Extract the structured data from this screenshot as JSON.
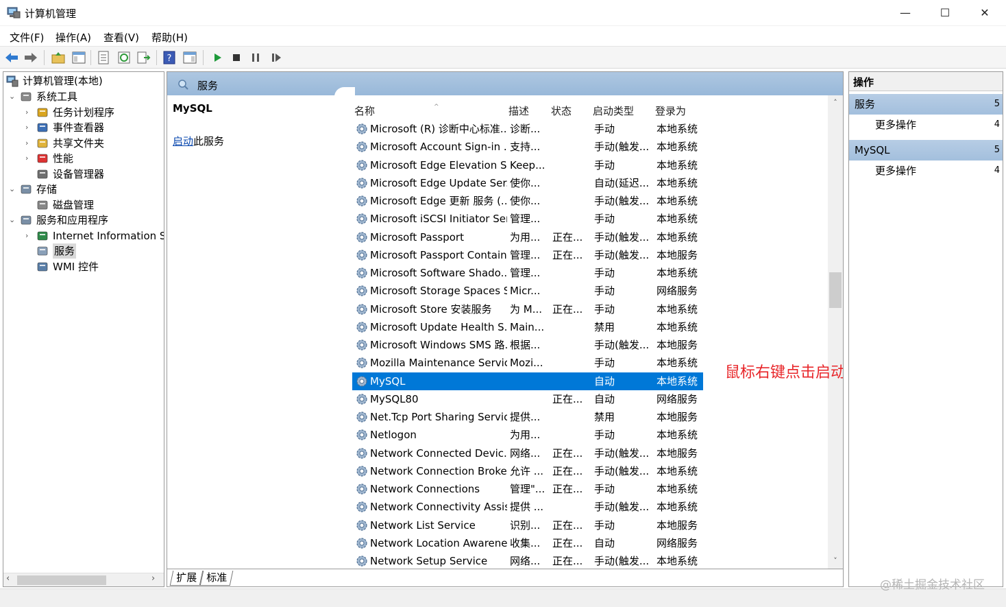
{
  "window": {
    "title": "计算机管理",
    "minimize": "—",
    "maximize": "☐",
    "close": "✕"
  },
  "menu": [
    "文件(F)",
    "操作(A)",
    "查看(V)",
    "帮助(H)"
  ],
  "tree": {
    "root": "计算机管理(本地)",
    "nodes": [
      {
        "label": "系统工具",
        "icon": "tools-icon",
        "level": 1,
        "expander": "⌄"
      },
      {
        "label": "任务计划程序",
        "icon": "clock-icon",
        "level": 2,
        "expander": "›"
      },
      {
        "label": "事件查看器",
        "icon": "event-viewer-icon",
        "level": 2,
        "expander": "›"
      },
      {
        "label": "共享文件夹",
        "icon": "shared-folder-icon",
        "level": 2,
        "expander": "›"
      },
      {
        "label": "性能",
        "icon": "performance-icon",
        "level": 2,
        "expander": "›"
      },
      {
        "label": "设备管理器",
        "icon": "device-manager-icon",
        "level": 2,
        "expander": ""
      },
      {
        "label": "存储",
        "icon": "storage-icon",
        "level": 1,
        "expander": "⌄"
      },
      {
        "label": "磁盘管理",
        "icon": "disk-icon",
        "level": 2,
        "expander": ""
      },
      {
        "label": "服务和应用程序",
        "icon": "services-apps-icon",
        "level": 1,
        "expander": "⌄"
      },
      {
        "label": "Internet Information Se",
        "icon": "iis-icon",
        "level": 2,
        "expander": "›"
      },
      {
        "label": "服务",
        "icon": "services-icon",
        "level": 2,
        "expander": "",
        "selected": true
      },
      {
        "label": "WMI 控件",
        "icon": "wmi-icon",
        "level": 2,
        "expander": ""
      }
    ]
  },
  "center": {
    "header": "服务",
    "detail_title": "MySQL",
    "detail_link": "启动",
    "detail_suffix": "此服务",
    "columns": {
      "name": "名称",
      "desc": "描述",
      "state": "状态",
      "startup": "启动类型",
      "logon": "登录为"
    },
    "sort_arrow": "^",
    "rows": [
      {
        "name": "Microsoft (R) 诊断中心标准...",
        "desc": "诊断...",
        "state": "",
        "startup": "手动",
        "logon": "本地系统"
      },
      {
        "name": "Microsoft Account Sign-in ...",
        "desc": "支持...",
        "state": "",
        "startup": "手动(触发...",
        "logon": "本地系统"
      },
      {
        "name": "Microsoft Edge Elevation S...",
        "desc": "Keep...",
        "state": "",
        "startup": "手动",
        "logon": "本地系统"
      },
      {
        "name": "Microsoft Edge Update Ser...",
        "desc": "使你...",
        "state": "",
        "startup": "自动(延迟...",
        "logon": "本地系统"
      },
      {
        "name": "Microsoft Edge 更新 服务 (...",
        "desc": "使你...",
        "state": "",
        "startup": "手动(触发...",
        "logon": "本地系统"
      },
      {
        "name": "Microsoft iSCSI Initiator Ser...",
        "desc": "管理...",
        "state": "",
        "startup": "手动",
        "logon": "本地系统"
      },
      {
        "name": "Microsoft Passport",
        "desc": "为用...",
        "state": "正在...",
        "startup": "手动(触发...",
        "logon": "本地系统"
      },
      {
        "name": "Microsoft Passport Container",
        "desc": "管理...",
        "state": "正在...",
        "startup": "手动(触发...",
        "logon": "本地服务"
      },
      {
        "name": "Microsoft Software Shado...",
        "desc": "管理...",
        "state": "",
        "startup": "手动",
        "logon": "本地系统"
      },
      {
        "name": "Microsoft Storage Spaces S...",
        "desc": "Micr...",
        "state": "",
        "startup": "手动",
        "logon": "网络服务"
      },
      {
        "name": "Microsoft Store 安装服务",
        "desc": "为 M...",
        "state": "正在...",
        "startup": "手动",
        "logon": "本地系统"
      },
      {
        "name": "Microsoft Update Health S...",
        "desc": "Main...",
        "state": "",
        "startup": "禁用",
        "logon": "本地系统"
      },
      {
        "name": "Microsoft Windows SMS 路...",
        "desc": "根据...",
        "state": "",
        "startup": "手动(触发...",
        "logon": "本地服务"
      },
      {
        "name": "Mozilla Maintenance Service",
        "desc": "Mozi...",
        "state": "",
        "startup": "手动",
        "logon": "本地系统"
      },
      {
        "name": "MySQL",
        "desc": "",
        "state": "",
        "startup": "自动",
        "logon": "本地系统",
        "selected": true
      },
      {
        "name": "MySQL80",
        "desc": "",
        "state": "正在...",
        "startup": "自动",
        "logon": "网络服务"
      },
      {
        "name": "Net.Tcp Port Sharing Service",
        "desc": "提供...",
        "state": "",
        "startup": "禁用",
        "logon": "本地服务"
      },
      {
        "name": "Netlogon",
        "desc": "为用...",
        "state": "",
        "startup": "手动",
        "logon": "本地系统"
      },
      {
        "name": "Network Connected Devic...",
        "desc": "网络...",
        "state": "正在...",
        "startup": "手动(触发...",
        "logon": "本地服务"
      },
      {
        "name": "Network Connection Broker",
        "desc": "允许 ...",
        "state": "正在...",
        "startup": "手动(触发...",
        "logon": "本地系统"
      },
      {
        "name": "Network Connections",
        "desc": "管理\"...",
        "state": "正在...",
        "startup": "手动",
        "logon": "本地系统"
      },
      {
        "name": "Network Connectivity Assis...",
        "desc": "提供 ...",
        "state": "",
        "startup": "手动(触发...",
        "logon": "本地系统"
      },
      {
        "name": "Network List Service",
        "desc": "识别...",
        "state": "正在...",
        "startup": "手动",
        "logon": "本地服务"
      },
      {
        "name": "Network Location Awarene...",
        "desc": "收集...",
        "state": "正在...",
        "startup": "自动",
        "logon": "网络服务"
      },
      {
        "name": "Network Setup Service",
        "desc": "网络...",
        "state": "正在...",
        "startup": "手动(触发...",
        "logon": "本地系统"
      }
    ],
    "annotation": "鼠标右键点击启动",
    "tabs": [
      "扩展",
      "标准"
    ],
    "scroll_up": "˄",
    "scroll_down": "˅"
  },
  "actions": {
    "header": "操作",
    "groups": [
      {
        "title": "服务",
        "count": "5",
        "items": [
          {
            "label": "更多操作",
            "count": "4"
          }
        ]
      },
      {
        "title": "MySQL",
        "count": "5",
        "items": [
          {
            "label": "更多操作",
            "count": "4"
          }
        ]
      }
    ]
  },
  "tree_scroll": {
    "left": "‹",
    "right": "›"
  },
  "watermark": "@稀土掘金技术社区",
  "colors": {
    "selection": "#0078d7",
    "annotation": "#e8262a",
    "pane_header": "#a3bfdd"
  }
}
